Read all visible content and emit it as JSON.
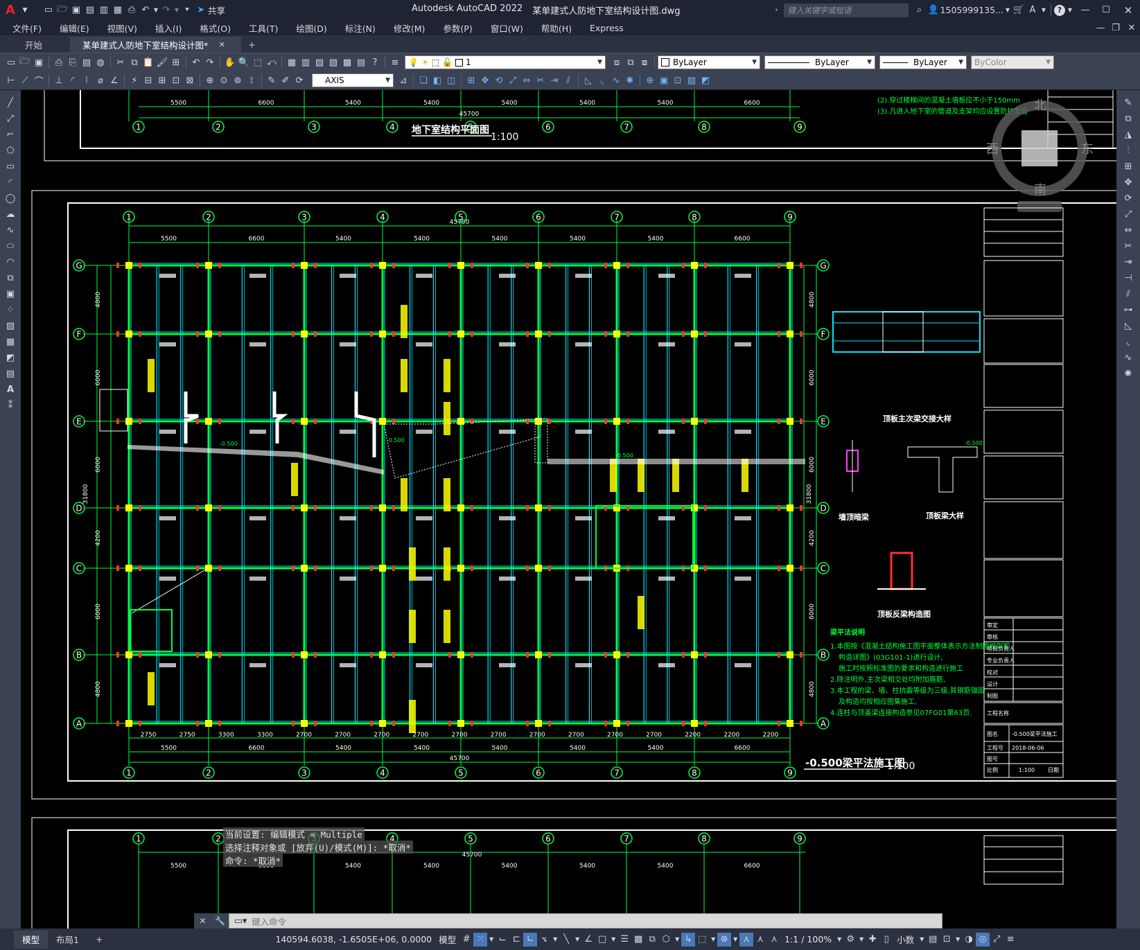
{
  "titlebar": {
    "app_letter": "A",
    "share_label": "共享",
    "app_name": "Autodesk AutoCAD 2022",
    "file_name": "某单建式人防地下室结构设计图.dwg",
    "search_placeholder": "键入关键字或短语",
    "user": "1505999135...",
    "help": "?"
  },
  "menubar": {
    "items": [
      "文件(F)",
      "编辑(E)",
      "视图(V)",
      "插入(I)",
      "格式(O)",
      "工具(T)",
      "绘图(D)",
      "标注(N)",
      "修改(M)",
      "参数(P)",
      "窗口(W)",
      "帮助(H)",
      "Express"
    ]
  },
  "doctabs": {
    "start": "开始",
    "active": "某单建式人防地下室结构设计图*",
    "add": "+"
  },
  "toolbar1": {
    "layer_value": "1",
    "color_value": "ByLayer",
    "linetype_value": "ByLayer",
    "lineweight_value": "ByLayer",
    "plotstyle_value": "ByColor"
  },
  "toolbar2": {
    "dimstyle_value": "AXIS"
  },
  "viewcube": {
    "north": "北",
    "south": "南",
    "west": "西",
    "east": "东"
  },
  "drawing": {
    "top_plan_title": "地下室结构平面图",
    "top_plan_scale": "1:100",
    "main_title": "-0.500梁平法施工图",
    "main_scale": "1:100",
    "top_total": "45700",
    "bottom_total": "45700",
    "axis_numbers": [
      "1",
      "2",
      "3",
      "4",
      "5",
      "6",
      "7",
      "8",
      "9"
    ],
    "axis_letters": [
      "G",
      "F",
      "E",
      "D",
      "C",
      "B",
      "A"
    ],
    "top_spans": [
      "5500",
      "6600",
      "5400",
      "5400",
      "5400",
      "5400",
      "5400",
      "6600"
    ],
    "bottom_spans": [
      "5500",
      "6600",
      "5400",
      "5400",
      "5400",
      "5400",
      "5400",
      "6600"
    ],
    "bottom_sub_spans": [
      "2750",
      "2750",
      "3300",
      "3300",
      "2700",
      "2700",
      "2700",
      "2700",
      "2700",
      "2700",
      "2700",
      "2700",
      "2700",
      "2700",
      "2200",
      "2200",
      "2200"
    ],
    "left_spans": [
      "4800",
      "6000",
      "6000",
      "4200",
      "6000",
      "4800"
    ],
    "total_height": "31800",
    "top_notes": [
      "(2).穿过楼梯间的混凝土墙板应不小于150mm",
      "(3).凡进入地下室的管道及支架均应设置防护套管"
    ],
    "detail_labels": [
      "顶板主次梁交接大样",
      "墙顶暗梁",
      "顶板梁大样",
      "顶板反梁构造图"
    ],
    "notes_title": "梁平法说明",
    "notes": [
      "1.本图按《混凝土结构施工图平面整体表示方法制图规则和",
      "构造详图》(03G101-1)进行设计,",
      "施工时按照标准图的要求和构造进行施工",
      "2.除注明外,主次梁相交处均附加箍筋,",
      "3.本工程的梁、墙、柱抗震等级为三级,其钢筋锚固",
      "及构造均按相应图集施工,",
      "4.连柱与顶盖梁连接构造参见07FG01第63页."
    ],
    "title_block_rows": [
      "审定",
      "审核",
      "项目负责人",
      "专业负责人",
      "校对",
      "设计",
      "制图"
    ],
    "title_block_project": "工程名称",
    "title_block_drawing_label": "图名",
    "title_block_drawing": "-0.500梁平法施工",
    "title_block_number_label": "工程号",
    "title_block_date": "2018-06-06",
    "title_block_scale_label": "比例",
    "title_block_scale": "1:100",
    "title_block_date_label": "日期",
    "title_block_drawing_no": "图号",
    "small_labels": [
      "-0.500",
      "-0.500",
      "-0.500",
      "-0.500"
    ]
  },
  "cmd": {
    "history": [
      "当前设置: 编辑模式 = Multiple",
      "选择注释对象或 [放弃(U)/模式(M)]: *取消*",
      "命令: *取消*"
    ],
    "input_placeholder": "键入命令"
  },
  "statusbar": {
    "tab_model": "模型",
    "tab_layout": "布局1",
    "tab_add": "+",
    "coords": "140594.6038, -1.6505E+06, 0.0000",
    "space": "模型",
    "scale": "1:1 / 100%",
    "units": "小数"
  },
  "colors": {
    "chrome": "#1e2431",
    "toolbar": "#3b4253",
    "canvas": "#000000",
    "grid_green": "#00ff3c",
    "cyan": "#00e5ff",
    "yellow": "#ffff00",
    "white": "#ffffff",
    "red": "#ff3030"
  }
}
